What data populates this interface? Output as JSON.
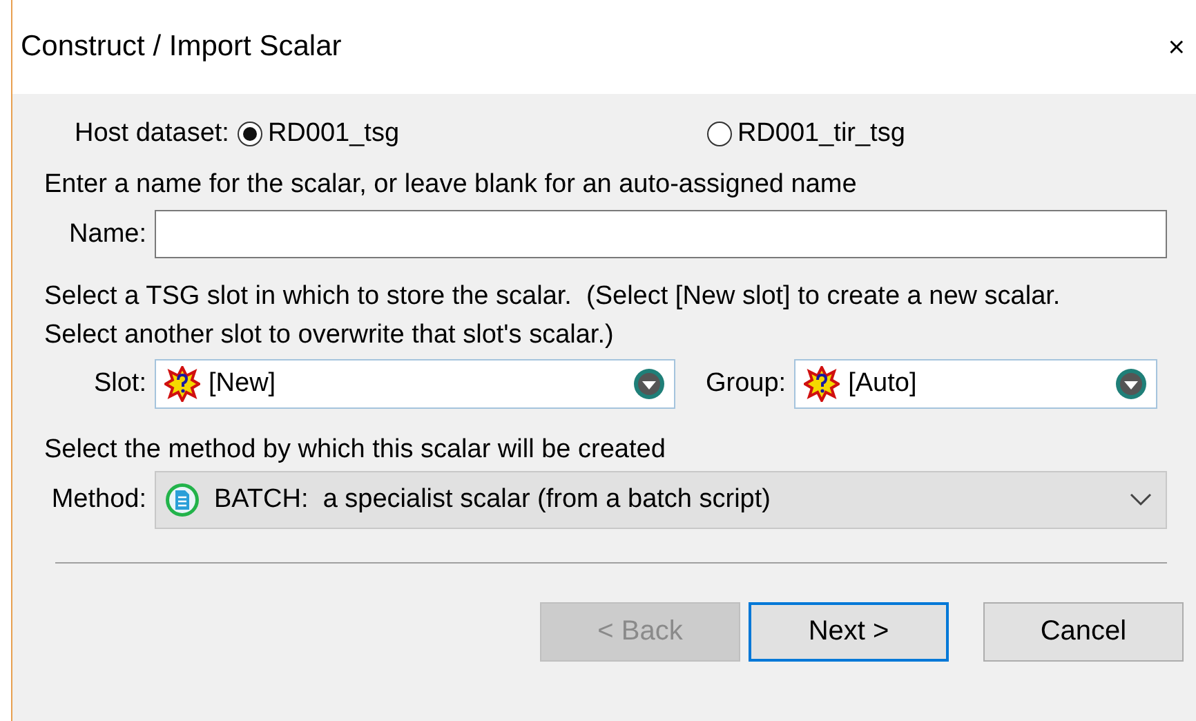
{
  "window": {
    "title": "Construct / Import Scalar",
    "close": "×"
  },
  "host_dataset": {
    "label": "Host dataset:",
    "options": [
      {
        "label": "RD001_tsg",
        "selected": true
      },
      {
        "label": "RD001_tir_tsg",
        "selected": false
      }
    ]
  },
  "name_section": {
    "instruction": "Enter a name for the scalar, or leave blank for an auto-assigned name",
    "label": "Name:"
  },
  "slot_section": {
    "instruction": "Select a TSG slot in which to store the scalar.  (Select [New slot] to create a new scalar.  Select another slot to overwrite that slot's scalar.)",
    "combos": [
      {
        "label": "Slot:",
        "value": "[New]"
      },
      {
        "label": "Group:",
        "value": "[Auto]"
      }
    ]
  },
  "method_section": {
    "instruction": "Select the method by which this scalar will be created",
    "label": "Method:",
    "value": "BATCH:  a specialist scalar (from a batch script)"
  },
  "buttons": [
    {
      "label": "< Back",
      "disabled": true,
      "default": false
    },
    {
      "label": "Next >",
      "disabled": false,
      "default": true
    },
    {
      "label": "Cancel",
      "disabled": false,
      "default": false
    }
  ]
}
